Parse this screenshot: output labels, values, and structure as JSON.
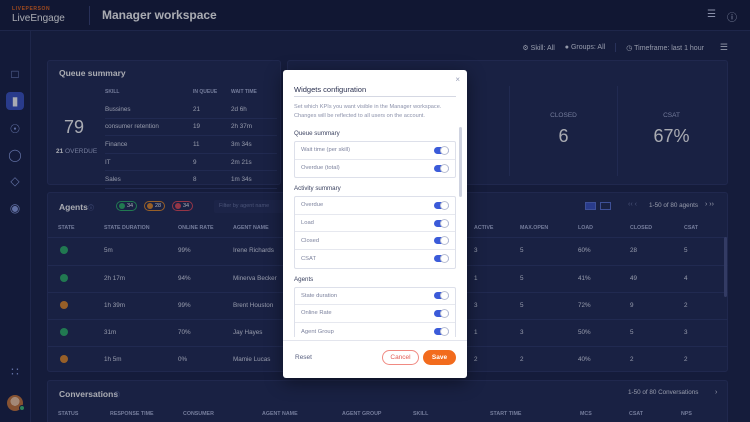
{
  "brand": {
    "tagline": "LIVEPERSON",
    "name": "LiveEngage"
  },
  "header": {
    "title": "Manager workspace"
  },
  "filters": {
    "skill": "Skill: All",
    "groups": "Groups: All",
    "timeframe": "Timeframe: last 1 hour"
  },
  "queue_summary": {
    "title": "Queue summary",
    "total": "79",
    "overdue_count": "21",
    "overdue_label": "OVERDUE",
    "columns": [
      "SKILL",
      "IN QUEUE",
      "WAIT TIME"
    ],
    "rows": [
      [
        "Bussines",
        "21",
        "2d 6h"
      ],
      [
        "consumer retention",
        "19",
        "2h 37m"
      ],
      [
        "Finance",
        "11",
        "3m 34s"
      ],
      [
        "IT",
        "9",
        "2m 21s"
      ],
      [
        "Sales",
        "8",
        "1m 34s"
      ]
    ]
  },
  "kpis": [
    {
      "label": "CLOSED",
      "value": "6"
    },
    {
      "label": "CSAT",
      "value": "67%"
    }
  ],
  "agents": {
    "title": "Agents",
    "badges": {
      "online": "34",
      "away": "28",
      "busy": "34"
    },
    "filter_placeholder": "Filter by agent name",
    "pagination": "1-50 of 80 agents",
    "columns": [
      "STATE",
      "STATE DURATION",
      "ONLINE RATE",
      "AGENT NAME",
      "ACTIVE",
      "MAX.OPEN",
      "LOAD",
      "CLOSED",
      "CSAT"
    ],
    "rows": [
      {
        "status": "online",
        "duration": "5m",
        "rate": "99%",
        "name": "Irene Richards",
        "active": "3",
        "max": "5",
        "load": "60%",
        "closed": "28",
        "csat": "5"
      },
      {
        "status": "online",
        "duration": "2h 17m",
        "rate": "94%",
        "name": "Minerva Becker",
        "active": "1",
        "max": "5",
        "load": "41%",
        "closed": "49",
        "csat": "4"
      },
      {
        "status": "away",
        "duration": "1h 39m",
        "rate": "99%",
        "name": "Brent Houston",
        "active": "3",
        "max": "5",
        "load": "72%",
        "closed": "9",
        "csat": "2"
      },
      {
        "status": "online",
        "duration": "31m",
        "rate": "70%",
        "name": "Jay Hayes",
        "active": "1",
        "max": "3",
        "load": "50%",
        "closed": "5",
        "csat": "3"
      },
      {
        "status": "away",
        "duration": "1h 5m",
        "rate": "0%",
        "name": "Mamie Lucas",
        "active": "2",
        "max": "2",
        "load": "40%",
        "closed": "2",
        "csat": "2"
      }
    ]
  },
  "conversations": {
    "title": "Conversations",
    "pagination": "1-50 of 80 Conversations",
    "columns": [
      "STATUS",
      "RESPONSE TIME",
      "CONSUMER",
      "AGENT NAME",
      "AGENT GROUP",
      "SKILL",
      "START TIME",
      "MCS",
      "CSAT",
      "NPS"
    ]
  },
  "modal": {
    "title": "Widgets configuration",
    "description": "Set which KPIs you want visible in the Manager workspace. Changes will be reflected to all users on the account.",
    "sections": [
      {
        "title": "Queue summary",
        "items": [
          "Wait time (per skill)",
          "Overdue (total)"
        ]
      },
      {
        "title": "Activity summary",
        "items": [
          "Overdue",
          "Load",
          "Closed",
          "CSAT"
        ]
      },
      {
        "title": "Agents",
        "items": [
          "State duration",
          "Online Rate",
          "Agent Group"
        ]
      }
    ],
    "reset": "Reset",
    "cancel": "Cancel",
    "save": "Save"
  },
  "colors": {
    "accent": "#f26b1d",
    "primary": "#3b5bd9",
    "background": "#1c2449"
  }
}
